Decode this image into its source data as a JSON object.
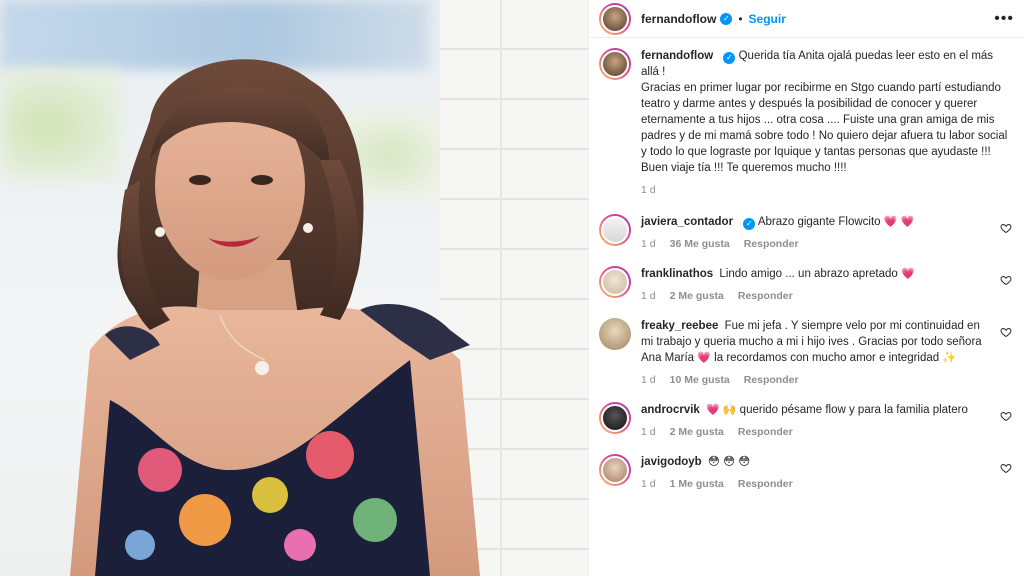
{
  "post": {
    "author": "fernandoflow",
    "follow_label": "Seguir",
    "separator": "•",
    "more_label": "•••",
    "caption_line1": "Querida tía Anita ojalá puedas leer esto en el más allá !",
    "caption_body": "Gracias en primer lugar por recibirme en Stgo cuando partí estudiando teatro y darme antes y después la posibilidad de conocer y querer eternamente a tus hijos ... otra cosa .... Fuiste una gran amiga de mis padres y de mi mamá sobre todo ! No quiero dejar afuera tu labor social y todo lo que lograste por Iquique y tantas personas que ayudaste !!! Buen viaje tía !!! Te queremos mucho !!!!",
    "time": "1 d"
  },
  "comments": [
    {
      "user": "javiera_contador",
      "verified": true,
      "text": "Abrazo gigante Flowcito",
      "emoji": "💗 💗",
      "time": "1 d",
      "likes": "36 Me gusta",
      "reply": "Responder"
    },
    {
      "user": "franklinathos",
      "verified": false,
      "text": "Lindo amigo ... un abrazo apretado",
      "emoji": "💗",
      "time": "1 d",
      "likes": "2 Me gusta",
      "reply": "Responder"
    },
    {
      "user": "freaky_reebee",
      "verified": false,
      "text": "Fue mi jefa . Y siempre velo por mi continuidad en mi trabajo y queria mucho a mi i hijo ives . Gracias por todo señora Ana María",
      "emoji": "💗",
      "text2": "la recordamos con mucho amor e integridad",
      "emoji2": "✨",
      "time": "1 d",
      "likes": "10 Me gusta",
      "reply": "Responder"
    },
    {
      "user": "androcrvik",
      "verified": false,
      "emoji": "💗 🙌",
      "text": "querido pésame flow y para la familia platero",
      "time": "1 d",
      "likes": "2 Me gusta",
      "reply": "Responder"
    },
    {
      "user": "javigodoyb",
      "verified": false,
      "text": "",
      "emoji": "😳 😳 😳",
      "time": "1 d",
      "likes": "1 Me gusta",
      "reply": "Responder"
    }
  ],
  "icons": {
    "like": "heart-outline-icon",
    "verified": "verified-badge-icon",
    "more": "more-options-icon"
  },
  "colors": {
    "accent": "#0095f6",
    "heart": "#e0245e",
    "muted": "#8e8e8e"
  }
}
